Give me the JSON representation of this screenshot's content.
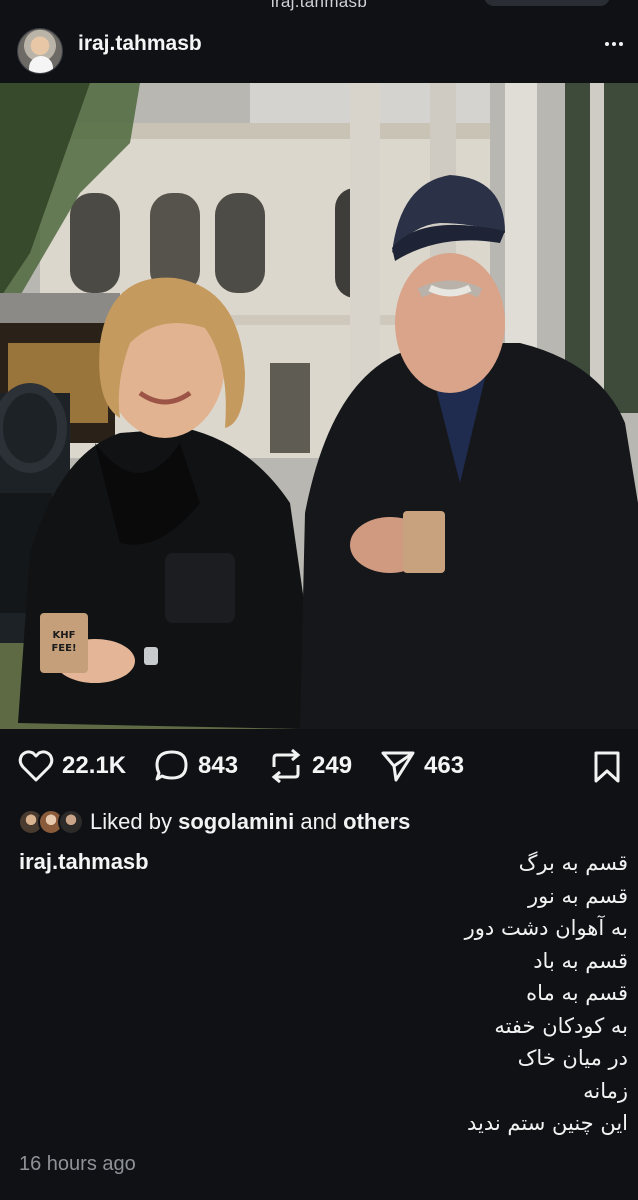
{
  "top_bar": {
    "url_text": "iraj.tahmasb"
  },
  "header": {
    "username": "iraj.tahmasb",
    "more_icon": "more-horizontal-icon"
  },
  "post_image": {
    "cup_text": "KHF FEE!"
  },
  "actions": {
    "likes": "22.1K",
    "comments": "843",
    "reposts": "249",
    "shares": "463",
    "icons": [
      "heart-icon",
      "comment-icon",
      "repost-icon",
      "share-icon",
      "bookmark-icon"
    ]
  },
  "liked_by": {
    "prefix": "Liked by",
    "user": "sogolamini",
    "joiner": "and",
    "others": "others"
  },
  "caption": {
    "username": "iraj.tahmasb",
    "lines": [
      "قسم به برگ",
      "قسم به نور",
      "به آهوان دشت دور",
      "قسم به باد",
      "قسم به ماه",
      "به کودکان خفته",
      "در میان خاک",
      "زمانه",
      "این چنین ستم ندید"
    ]
  },
  "timestamp": "16 hours ago",
  "colors": {
    "background": "#0f1115",
    "text": "#f2f2f2",
    "muted": "#8e9196"
  }
}
